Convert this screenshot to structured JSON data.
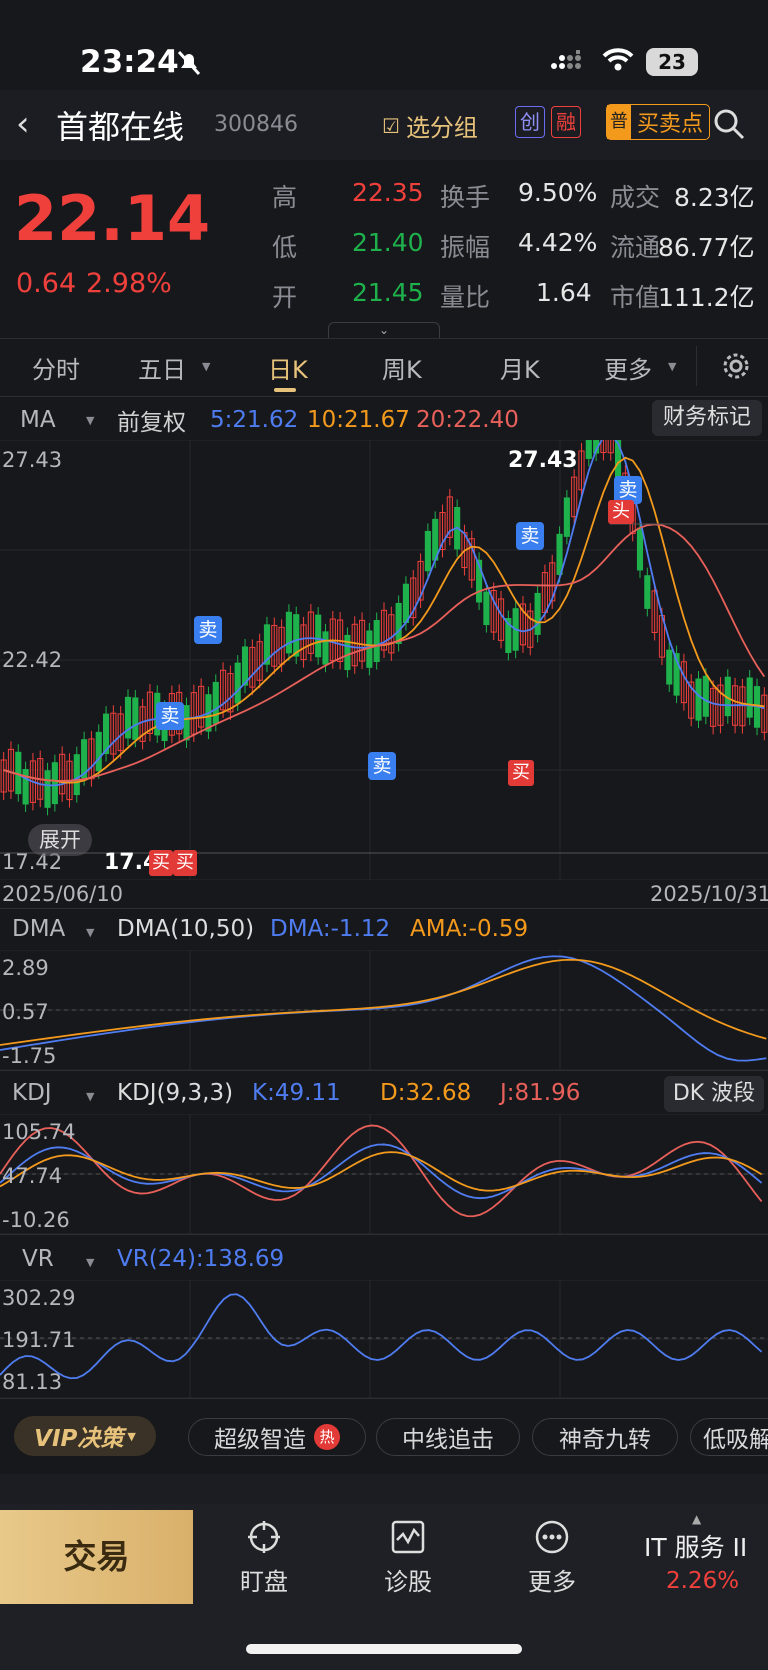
{
  "status": {
    "time": "23:24",
    "battery": "23"
  },
  "header": {
    "back_icon": "chevron-left-icon",
    "name": "首都在线",
    "code": "300846",
    "group_btn": "选分组",
    "tag1": "创",
    "tag2": "融",
    "tag3": "普",
    "buy_sell_btn": "买卖点"
  },
  "quote": {
    "price": "22.14",
    "change": "0.64",
    "change_pct": "2.98%",
    "stats": [
      {
        "k": "高",
        "v": "22.35"
      },
      {
        "k": "换手",
        "v": "9.50%"
      },
      {
        "k": "成交",
        "v": "8.23亿"
      },
      {
        "k": "低",
        "v": "21.40"
      },
      {
        "k": "振幅",
        "v": "4.42%"
      },
      {
        "k": "流通",
        "v": "86.77亿"
      },
      {
        "k": "开",
        "v": "21.45"
      },
      {
        "k": "量比",
        "v": "1.64"
      },
      {
        "k": "市值",
        "v": "111.2亿"
      }
    ]
  },
  "tabs": [
    "分时",
    "五日",
    "日K",
    "周K",
    "月K",
    "更多"
  ],
  "ma": {
    "label": "MA",
    "adj": "前复权",
    "ma5": "5:21.62",
    "ma10": "10:21.67",
    "ma20": "20:22.40",
    "fin_btn": "财务标记",
    "y_top": "27.43",
    "y_mid": "22.42",
    "y_bot": "17.42",
    "high_mark": "27.43",
    "low_mark": "17.4",
    "date_start": "2025/06/10",
    "date_end": "2025/10/31",
    "expand": "展开",
    "buy": "买",
    "sell": "卖",
    "head": "头"
  },
  "dma": {
    "label": "DMA",
    "params": "DMA(10,50)",
    "dma": "DMA:-1.12",
    "ama": "AMA:-0.59",
    "y1": "2.89",
    "y2": "0.57",
    "y3": "-1.75"
  },
  "kdj": {
    "label": "KDJ",
    "params": "KDJ(9,3,3)",
    "k": "K:49.11",
    "d": "D:32.68",
    "j": "J:81.96",
    "btn": "DK 波段",
    "y1": "105.74",
    "y2": "47.74",
    "y3": "-10.26"
  },
  "vr": {
    "label": "VR",
    "val": "VR(24):138.69",
    "y1": "302.29",
    "y2": "191.71",
    "y3": "81.13"
  },
  "strategy": {
    "vip": "VIP决策",
    "items": [
      "超级智造",
      "中线追击",
      "神奇九转",
      "低吸解"
    ],
    "hot": "热"
  },
  "nav": {
    "trade": "交易",
    "watch": "盯盘",
    "diag": "诊股",
    "more": "更多",
    "sector": "IT 服务 II",
    "sector_pct": "2.26%"
  },
  "colors": {
    "bg": "#17181c",
    "up": "#f0403c",
    "down": "#1fb24c",
    "ma5": "#4f7df1",
    "ma10": "#f39a1d",
    "ma20": "#e8605a",
    "gold": "#e7c27b"
  }
}
